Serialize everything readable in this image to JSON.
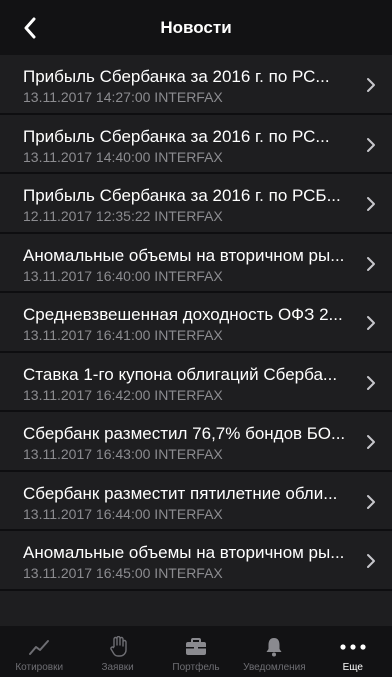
{
  "header": {
    "title": "Новости"
  },
  "news": [
    {
      "title": "Прибыль Сбербанка за 2016 г. по РС...",
      "meta": "13.11.2017 14:27:00 INTERFAX"
    },
    {
      "title": "Прибыль Сбербанка за 2016 г. по РС...",
      "meta": "13.11.2017 14:40:00 INTERFAX"
    },
    {
      "title": "Прибыль Сбербанка за 2016 г. по РСБ...",
      "meta": "12.11.2017 12:35:22 INTERFAX"
    },
    {
      "title": "Аномальные объемы на вторичном ры...",
      "meta": "13.11.2017 16:40:00 INTERFAX"
    },
    {
      "title": "Средневзвешенная доходность ОФЗ 2...",
      "meta": "13.11.2017 16:41:00 INTERFAX"
    },
    {
      "title": "Ставка 1-го купона облигаций Сберба...",
      "meta": "13.11.2017 16:42:00 INTERFAX"
    },
    {
      "title": "Сбербанк разместил 76,7% бондов БО...",
      "meta": "13.11.2017 16:43:00 INTERFAX"
    },
    {
      "title": "Сбербанк разместит пятилетние обли...",
      "meta": "13.11.2017 16:44:00 INTERFAX"
    },
    {
      "title": "Аномальные объемы на вторичном ры...",
      "meta": "13.11.2017 16:45:00 INTERFAX"
    }
  ],
  "tabbar": {
    "tabs": [
      {
        "label": "Котировки",
        "icon": "chart-line-icon"
      },
      {
        "label": "Заявки",
        "icon": "hand-icon"
      },
      {
        "label": "Портфель",
        "icon": "briefcase-icon"
      },
      {
        "label": "Уведомления",
        "icon": "bell-icon"
      },
      {
        "label": "Еще",
        "icon": "more-dots-icon"
      }
    ],
    "active_index": 4
  },
  "colors": {
    "background": "#1e1e20",
    "bar": "#121214",
    "secondary_text": "#8c8c90",
    "inactive_tab": "#6e6e73"
  }
}
